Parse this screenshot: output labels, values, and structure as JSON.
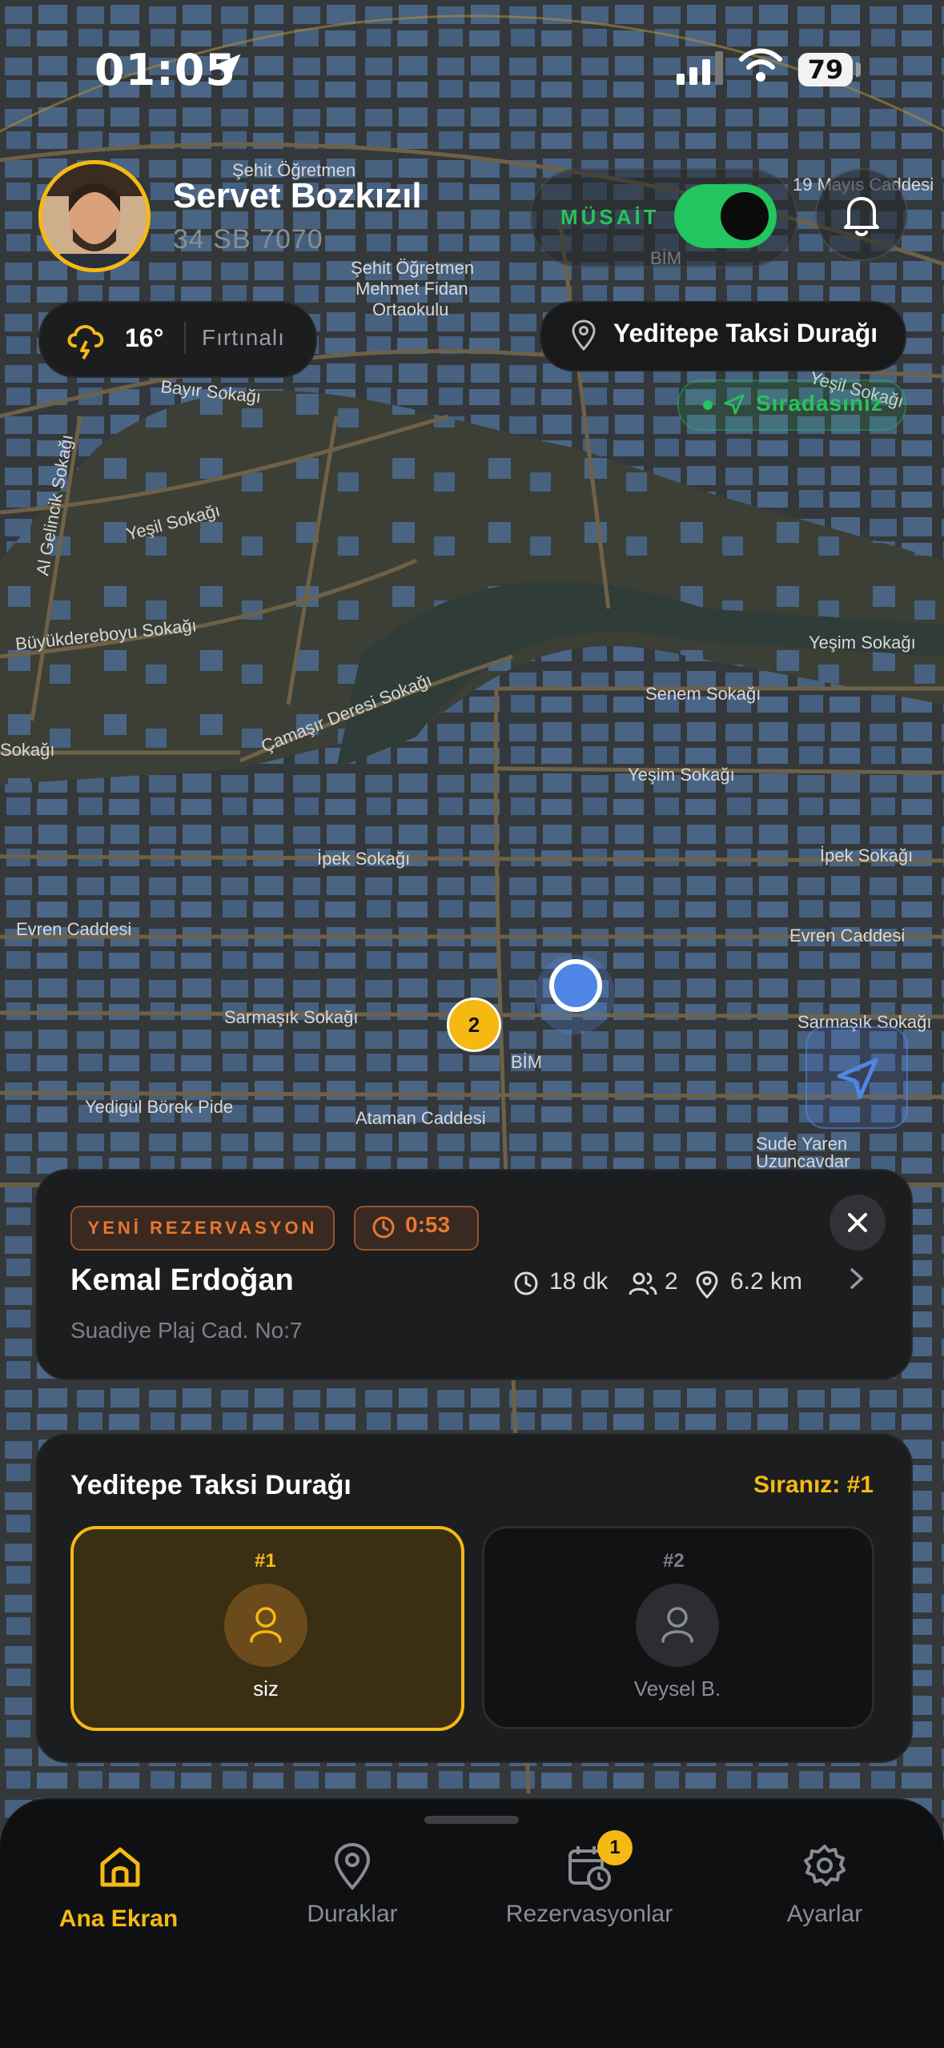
{
  "status_bar": {
    "time": "01:05",
    "battery": "79"
  },
  "map": {
    "streets": [
      "Şehit Öğretmen",
      "Şehit Öğretmen Mehmet Fidan Ortaokulu",
      "19 Mayıs Caddesi",
      "Bayır Sokağı",
      "Yeşil Sokağı",
      "Al Gelincik Sokağı",
      "Büyükdereboyu Sokağı",
      "Çamaşır Deresi Sokağı",
      "Senem Sokağı",
      "Yeşim Sokağı",
      "İpek Sokağı",
      "Evren Caddesi",
      "Sarmaşık Sokağı",
      "Yedigül Börek Pide",
      "Ataman Caddesi",
      "Sude Yaren Uzuncavdar",
      "BİM",
      "Sokağı"
    ],
    "cluster_count": "2"
  },
  "driver": {
    "name": "Servet Bozkızıl",
    "plate": "34 SB 7070"
  },
  "availability": {
    "label": "MÜSAİT",
    "on": true
  },
  "weather": {
    "temp": "16°",
    "condition": "Fırtınalı",
    "icon": "storm-icon"
  },
  "station": {
    "name": "Yeditepe Taksi Durağı",
    "queue_label": "Sıradasınız"
  },
  "reservation": {
    "tag": "YENİ REZERVASYON",
    "timer": "0:53",
    "customer": "Kemal Erdoğan",
    "duration": "18 dk",
    "passengers": "2",
    "distance": "6.2 km",
    "address": "Suadiye Plaj Cad. No:7"
  },
  "stand": {
    "title": "Yeditepe Taksi Durağı",
    "rank": "Sıranız: #1",
    "slots": [
      {
        "num": "#1",
        "name": "siz"
      },
      {
        "num": "#2",
        "name": "Veysel B."
      }
    ]
  },
  "tabs": [
    {
      "label": "Ana Ekran",
      "icon": "home-icon",
      "active": true
    },
    {
      "label": "Duraklar",
      "icon": "pin-icon"
    },
    {
      "label": "Rezervasyonlar",
      "icon": "calendar-icon",
      "badge": "1"
    },
    {
      "label": "Ayarlar",
      "icon": "gear-icon"
    }
  ],
  "colors": {
    "accent": "#f5b912",
    "available": "#22c55e",
    "alert": "#e8772f",
    "location": "#4f86e6"
  }
}
